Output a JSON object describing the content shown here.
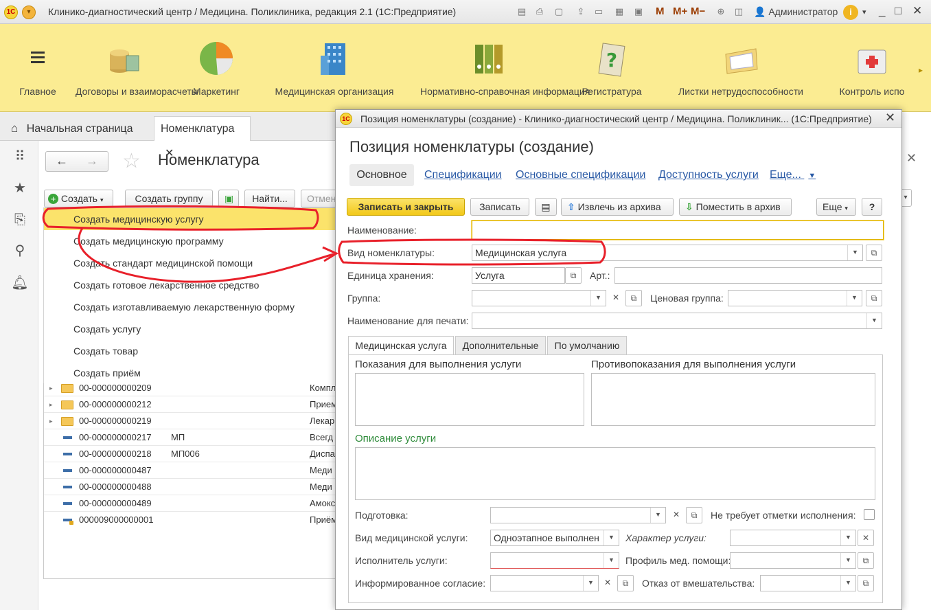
{
  "app": {
    "title": "Клинико-диагностический центр / Медицина. Поликлиника, редакция 2.1  (1С:Предприятие)",
    "logo_text": "1С",
    "user": "Администратор",
    "m_buttons": [
      "M",
      "M+",
      "M−"
    ],
    "window_controls": [
      "_",
      "□",
      "✕"
    ]
  },
  "sections": [
    {
      "label": "Главное",
      "icon": "menu-lines-icon"
    },
    {
      "label": "Договоры и взаиморасчеты",
      "icon": "coins-icon"
    },
    {
      "label": "Маркетинг",
      "icon": "pie-chart-icon"
    },
    {
      "label": "Медицинская организация",
      "icon": "building-icon"
    },
    {
      "label": "Нормативно-справочная информация",
      "icon": "binders-icon"
    },
    {
      "label": "Регистратура",
      "icon": "question-clipboard-icon"
    },
    {
      "label": "Листки нетрудоспособности",
      "icon": "folder-notes-icon"
    },
    {
      "label": "Контроль испо",
      "icon": "first-aid-icon"
    }
  ],
  "tabs": {
    "home": "Начальная страница",
    "nomenclature": "Номенклатура"
  },
  "nomenclature": {
    "title": "Номенклатура",
    "toolbar": {
      "create": "Создать",
      "create_group": "Создать группу",
      "find": "Найти...",
      "cancel_search": "Отмен"
    },
    "create_menu": [
      "Создать медицинскую услугу",
      "Создать медицинскую программу",
      "Создать стандарт медицинской помощи",
      "Создать готовое лекарственное средство",
      "Создать изготавливаемую лекарственную форму",
      "Создать услугу",
      "Создать товар",
      "Создать приём"
    ],
    "rows": [
      {
        "type": "folder",
        "code": "00-000000000209",
        "art": "",
        "name": "Компл"
      },
      {
        "type": "folder",
        "code": "00-000000000212",
        "art": "",
        "name": "Прием"
      },
      {
        "type": "folder",
        "code": "00-000000000219",
        "art": "",
        "name": "Лекар"
      },
      {
        "type": "item",
        "code": "00-000000000217",
        "art": "МП",
        "name": "Всегд"
      },
      {
        "type": "item",
        "code": "00-000000000218",
        "art": "МП006",
        "name": "Диспа"
      },
      {
        "type": "item",
        "code": "00-000000000487",
        "art": "",
        "name": "Меди"
      },
      {
        "type": "item",
        "code": "00-000000000488",
        "art": "",
        "name": "Меди"
      },
      {
        "type": "item",
        "code": "00-000000000489",
        "art": "",
        "name": "Амокс"
      },
      {
        "type": "item-locked",
        "code": "000009000000001",
        "art": "",
        "name": "Приём"
      }
    ]
  },
  "dialog": {
    "window_title": "Позиция номенклатуры (создание) - Клинико-диагностический центр / Медицина. Поликлиник...  (1С:Предприятие)",
    "heading": "Позиция номенклатуры (создание)",
    "tabs": [
      "Основное",
      "Спецификации",
      "Основные спецификации",
      "Доступность услуги",
      "Еще..."
    ],
    "toolbar": {
      "save_close": "Записать и закрыть",
      "save": "Записать",
      "unarchive": "Извлечь из архива",
      "archive": "Поместить в архив",
      "more": "Еще",
      "help": "?"
    },
    "fields": {
      "name_label": "Наименование:",
      "name_value": "",
      "kind_label": "Вид номенклатуры:",
      "kind_value": "Медицинская услуга",
      "unit_label": "Единица хранения:",
      "unit_value": "Услуга",
      "art_label": "Арт.:",
      "art_value": "",
      "group_label": "Группа:",
      "group_value": "",
      "price_group_label": "Ценовая группа:",
      "price_group_value": "",
      "print_name_label": "Наименование для печати:",
      "print_name_value": ""
    },
    "inner_tabs": [
      "Медицинская услуга",
      "Дополнительные",
      "По умолчанию"
    ],
    "inner": {
      "indications": "Показания для выполнения услуги",
      "contraindications": "Противопоказания для выполнения услуги",
      "description": "Описание услуги",
      "preparation_label": "Подготовка:",
      "no_mark_label": "Не требует отметки исполнения:",
      "service_kind_label": "Вид медицинской услуги:",
      "service_kind_value": "Одноэтапное выполнен",
      "service_nature_label": "Характер услуги:",
      "executor_label": "Исполнитель услуги:",
      "profile_label": "Профиль мед. помощи:",
      "consent_label": "Информированное согласие:",
      "refusal_label": "Отказ от вмешательства:"
    },
    "accent_color": "#f2c818",
    "description_color": "#2e8b3a"
  },
  "annotation_color": "#e8202a"
}
